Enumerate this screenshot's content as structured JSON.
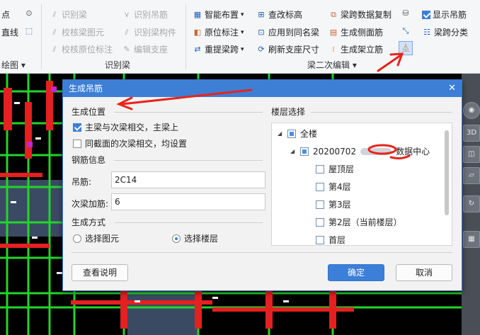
{
  "ribbon": {
    "left_items": [
      {
        "icon": "dot-icon",
        "label": "点",
        "disabled": false
      },
      {
        "icon": "line-icon",
        "label": "直线",
        "disabled": false
      }
    ],
    "left_group_label": "绘图",
    "mid_items": [
      {
        "icon": "beam-icon",
        "label": "识别梁",
        "disabled": true
      },
      {
        "icon": "check-icon",
        "label": "校核梁图元",
        "disabled": true
      },
      {
        "icon": "check-icon",
        "label": "校核原位标注",
        "disabled": true
      },
      {
        "icon": "hanger-icon",
        "label": "识别吊筋",
        "disabled": true
      },
      {
        "icon": "component-icon",
        "label": "识别梁构件",
        "disabled": true
      },
      {
        "icon": "edit-icon",
        "label": "编辑支座",
        "disabled": true
      }
    ],
    "mid_group_label": "识别梁",
    "right_items": [
      {
        "icon": "smart-layout-icon",
        "label": "智能布置",
        "dropdown": true
      },
      {
        "icon": "tag-icon",
        "label": "原位标注",
        "dropdown": true
      },
      {
        "icon": "span-icon",
        "label": "重提梁跨",
        "dropdown": true
      },
      {
        "icon": "elevation-icon",
        "label": "查改标高"
      },
      {
        "icon": "apply-icon",
        "label": "应用到同名梁"
      },
      {
        "icon": "refresh-icon",
        "label": "刷新支座尺寸"
      },
      {
        "icon": "copy-icon",
        "label": "梁跨数据复制"
      },
      {
        "icon": "side-rebar-icon",
        "label": "生成侧面筋"
      },
      {
        "icon": "stirrup-icon",
        "label": "生成架立筋"
      },
      {
        "icon": "display-hanger-icon",
        "label": "显示吊筋",
        "checked": true
      },
      {
        "icon": "span-class-icon",
        "label": "梁跨分类"
      }
    ],
    "right_group_label": "梁二次编辑"
  },
  "dialog": {
    "title": "生成吊筋",
    "position_section": "生成位置",
    "opt_main_secondary": "主梁与次梁相交，主梁上",
    "opt_main_secondary_checked": true,
    "opt_same_section": "同截面的次梁相交，均设置",
    "opt_same_section_checked": false,
    "rebar_section": "钢筋信息",
    "hanger_label": "吊筋:",
    "hanger_value": "2C14",
    "extra_label": "次梁加筋:",
    "extra_value": "6",
    "method_section": "生成方式",
    "method_options": [
      "选择图元",
      "选择楼层"
    ],
    "method_selected": 1,
    "floor_section": "楼层选择",
    "tree": {
      "root": "全楼",
      "project": "20200702",
      "project_suffix": "数据中心",
      "floors": [
        "屋顶层",
        "第4层",
        "第3层",
        "第2层（当前楼层）",
        "首层"
      ]
    },
    "help_button": "查看说明",
    "ok_button": "确定",
    "cancel_button": "取消"
  },
  "colors": {
    "accent": "#3d7fd4",
    "annotation": "#e8241c"
  }
}
